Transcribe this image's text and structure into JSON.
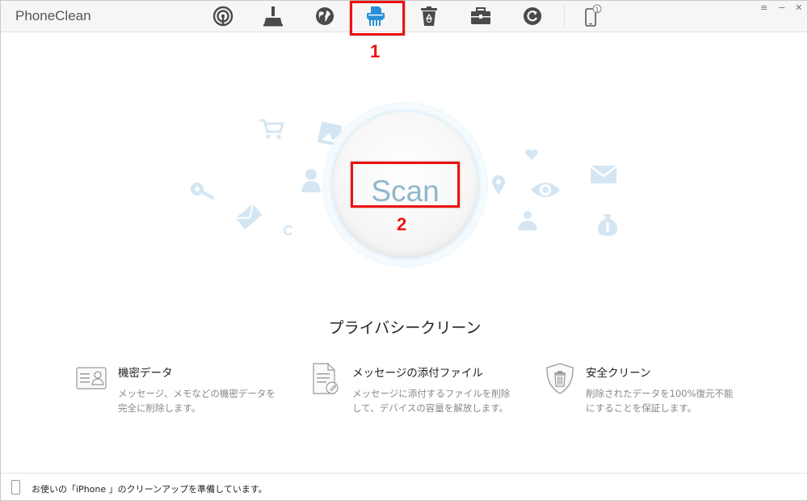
{
  "app": {
    "title": "PhoneClean"
  },
  "toolbar": {
    "tools": [
      {
        "name": "hotspot-tool",
        "icon": "radar-icon"
      },
      {
        "name": "quick-clean-tool",
        "icon": "broom-icon"
      },
      {
        "name": "internet-clean-tool",
        "icon": "globe-icon"
      },
      {
        "name": "privacy-clean-tool",
        "icon": "shredder-icon"
      },
      {
        "name": "system-junk-tool",
        "icon": "recycle-bin-icon"
      },
      {
        "name": "toolbox-tool",
        "icon": "toolbox-icon"
      },
      {
        "name": "backup-tool",
        "icon": "refresh-circle-icon"
      },
      {
        "name": "device-tool",
        "icon": "phone-icon",
        "badge": "1"
      }
    ],
    "accent": "#2a8fd6",
    "menu_glyph": "≡",
    "minimize_glyph": "−",
    "close_glyph": "✕"
  },
  "annotations": {
    "box1_number": "1",
    "box2_number": "2",
    "color": "#e11111"
  },
  "scan": {
    "label": "Scan"
  },
  "section": {
    "title": "プライバシークリーン"
  },
  "features": [
    {
      "title": "機密データ",
      "desc_line1": "メッセージ、メモなどの機密データを",
      "desc_line2": "完全に削除します。",
      "icon": "contact-card-icon"
    },
    {
      "title": "メッセージの添付ファイル",
      "desc_line1": "メッセージに添付するファイルを削除",
      "desc_line2": "して、デバイスの容量を解放します。",
      "icon": "attachment-document-icon"
    },
    {
      "title": "安全クリーン",
      "desc_line1": "削除されたデータを100%復元不能",
      "desc_line2": "にすることを保証します。",
      "icon": "shield-trash-icon"
    }
  ],
  "status": {
    "text": "お使いの「iPhone 」のクリーンアップを準備しています。"
  }
}
